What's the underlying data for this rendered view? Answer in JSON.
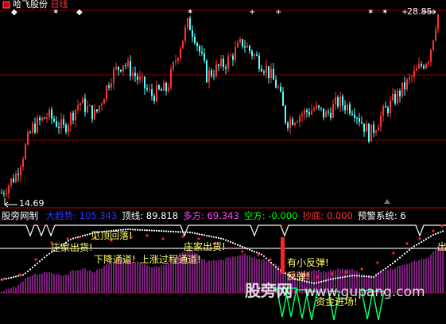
{
  "header": {
    "stock_name": "哈飞股份",
    "period": "日线",
    "high_price": "28.85",
    "low_price": "14.69"
  },
  "indicator": {
    "name": "股旁网制",
    "items": [
      {
        "label": "大趋势",
        "value": "105.343",
        "color": "#3333ff"
      },
      {
        "label": "顶线",
        "value": "89.818",
        "color": "#ffffff"
      },
      {
        "label": "多方",
        "value": "69.343",
        "color": "#ff44ff"
      },
      {
        "label": "空方",
        "value": "-0.000",
        "color": "#00ff00"
      },
      {
        "label": "抄底",
        "value": "0.000",
        "color": "#ff3333"
      },
      {
        "label": "预警系统",
        "value": "6",
        "color": "#ffffff"
      }
    ]
  },
  "annotations": {
    "jian_ding": "见顶回落!",
    "zhuang_chu_1": "庄家出货!",
    "zhuang_chu_2": "庄家出货!",
    "xia_jiang": "下降通道!",
    "shang_zhang": "上涨过程",
    "zheng_ti": "通道!",
    "small_rebound": "有小反弹!",
    "rebound": "反弹!",
    "capital_in": "资金进场!",
    "right_mark": "出"
  },
  "watermark": {
    "name": "股旁网",
    "url": "www.gupang.com"
  },
  "colors": {
    "up_candle": "#ff3333",
    "down_candle": "#54ffff",
    "grid_red": "#8b0000",
    "histogram": "#cc33cc",
    "trend_line": "#ffffff",
    "red_dots": "#ff2222",
    "green_spikes": "#00ff66"
  }
}
